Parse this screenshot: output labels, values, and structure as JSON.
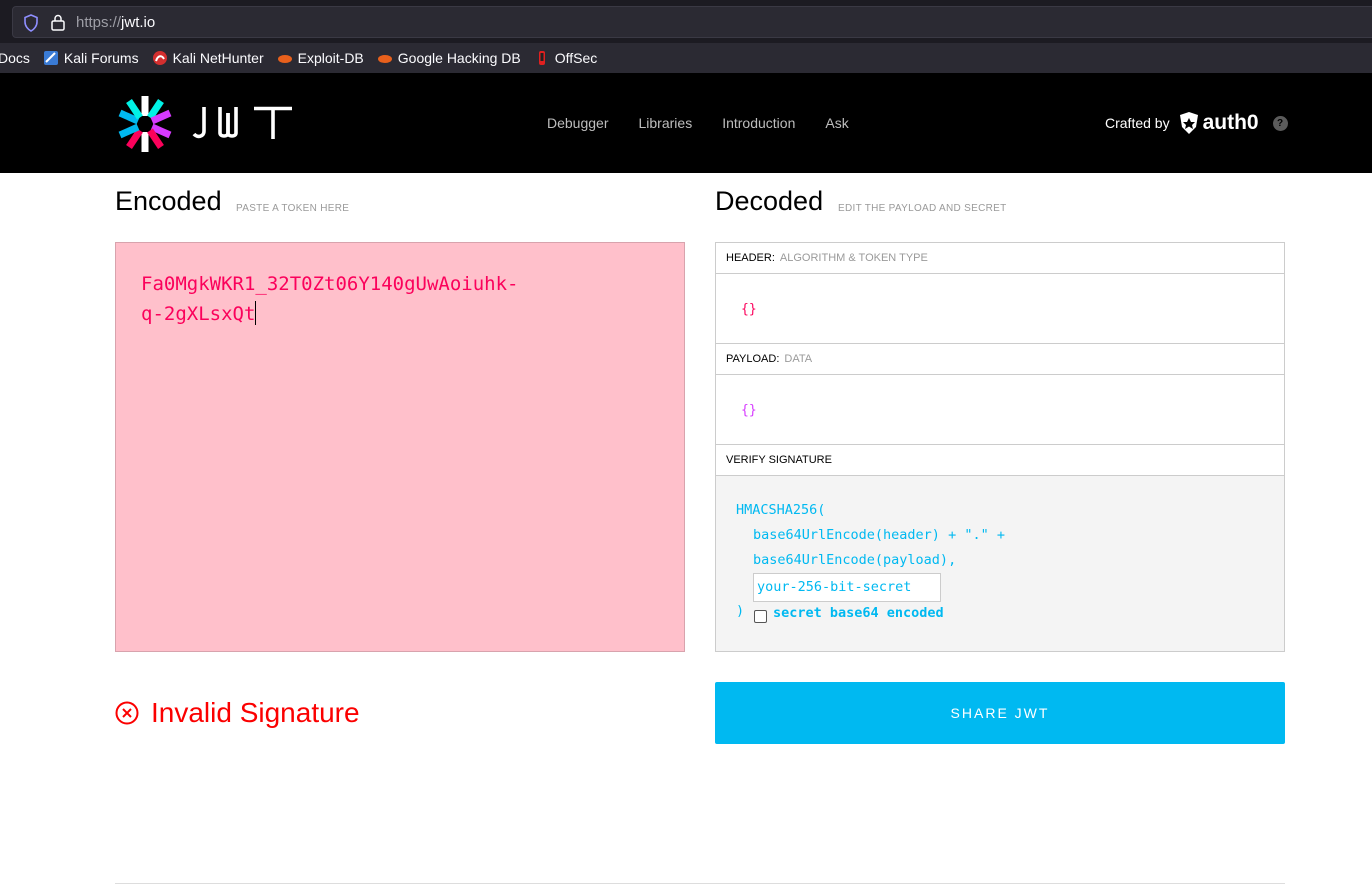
{
  "browser": {
    "url_scheme": "https://",
    "url_host": "jwt.io",
    "bookmarks": [
      {
        "label": "Docs",
        "icon": "kali-docs-icon"
      },
      {
        "label": "Kali Forums",
        "icon": "kali-forums-icon"
      },
      {
        "label": "Kali NetHunter",
        "icon": "kali-nethunter-icon"
      },
      {
        "label": "Exploit-DB",
        "icon": "exploit-db-icon"
      },
      {
        "label": "Google Hacking DB",
        "icon": "ghdb-icon"
      },
      {
        "label": "OffSec",
        "icon": "offsec-icon"
      }
    ]
  },
  "header": {
    "nav": [
      "Debugger",
      "Libraries",
      "Introduction",
      "Ask"
    ],
    "crafted_by": "Crafted by",
    "brand": "auth0",
    "help": "?"
  },
  "encoded": {
    "title": "Encoded",
    "subtitle": "PASTE A TOKEN HERE",
    "token_line1": "Fa0MgkWKR1_32T0Zt06Y140gUwAoiuhk-",
    "token_line2": "q-2gXLsxQt"
  },
  "decoded": {
    "title": "Decoded",
    "subtitle": "EDIT THE PAYLOAD AND SECRET",
    "header_label": "HEADER:",
    "header_hint": "ALGORITHM & TOKEN TYPE",
    "header_json": "{}",
    "payload_label": "PAYLOAD:",
    "payload_hint": "DATA",
    "payload_json": "{}",
    "verify_label": "VERIFY SIGNATURE",
    "sig_line1": "HMACSHA256(",
    "sig_line2": "base64UrlEncode(header) + \".\" +",
    "sig_line3": "base64UrlEncode(payload),",
    "secret_placeholder": "your-256-bit-secret",
    "sig_close": ")",
    "base64_label": "secret base64 encoded"
  },
  "status": {
    "invalid_text": "Invalid Signature"
  },
  "share": {
    "label": "SHARE JWT"
  },
  "colors": {
    "token": "#fb015b",
    "header_json": "#fb015b",
    "payload_json": "#d63aff",
    "signature": "#00b9f1",
    "invalid": "#fb0000",
    "encoded_bg": "#ffc0cb"
  }
}
